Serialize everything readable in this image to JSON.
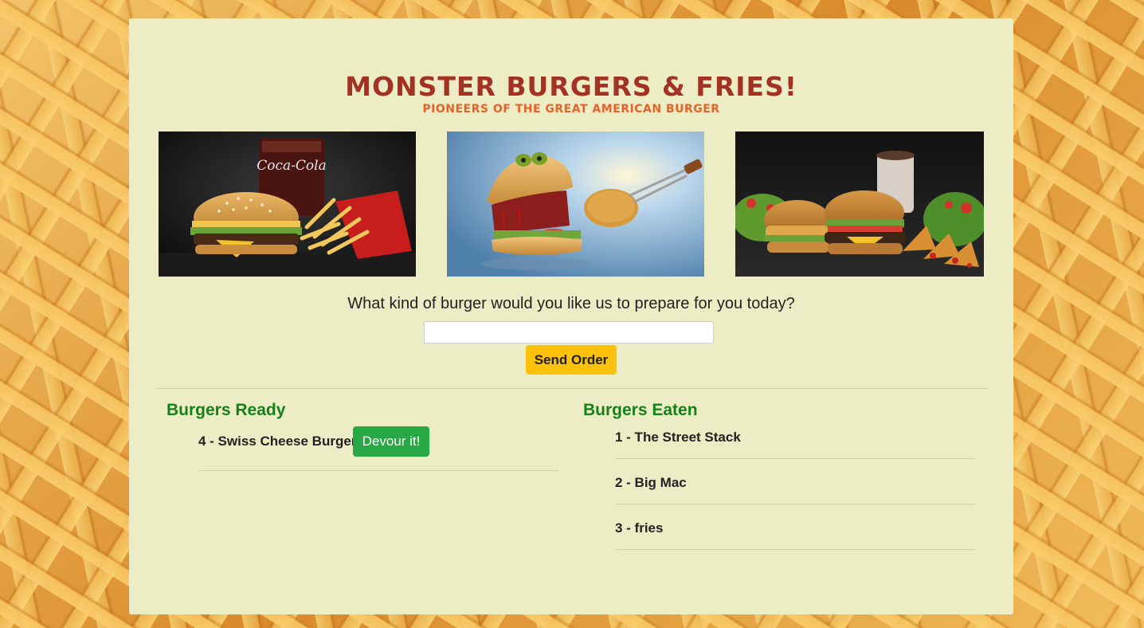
{
  "header": {
    "title": "Monster Burgers & Fries!",
    "subtitle": "Pioneers of the great American burger"
  },
  "photos": [
    {
      "icon": "burger-cola-fries-photo"
    },
    {
      "icon": "monster-burger-photo"
    },
    {
      "icon": "burger-spread-photo"
    }
  ],
  "order_form": {
    "question": "What kind of burger would you like us to prepare for you today?",
    "input_value": "",
    "input_placeholder": "",
    "send_label": "Send Order"
  },
  "ready": {
    "heading": "Burgers Ready",
    "items": [
      {
        "label": "4 - Swiss Cheese Burger",
        "button_label": "Devour it!"
      }
    ]
  },
  "eaten": {
    "heading": "Burgers Eaten",
    "items": [
      {
        "label": "1 - The Street Stack"
      },
      {
        "label": "2 - Big Mac"
      },
      {
        "label": "3 - fries"
      }
    ]
  },
  "colors": {
    "title": "#a33224",
    "subtitle": "#e8612a",
    "panel": "#ecedc4",
    "send_button": "#fcc20b",
    "devour_button": "#28a745",
    "section_heading": "#17801a"
  }
}
